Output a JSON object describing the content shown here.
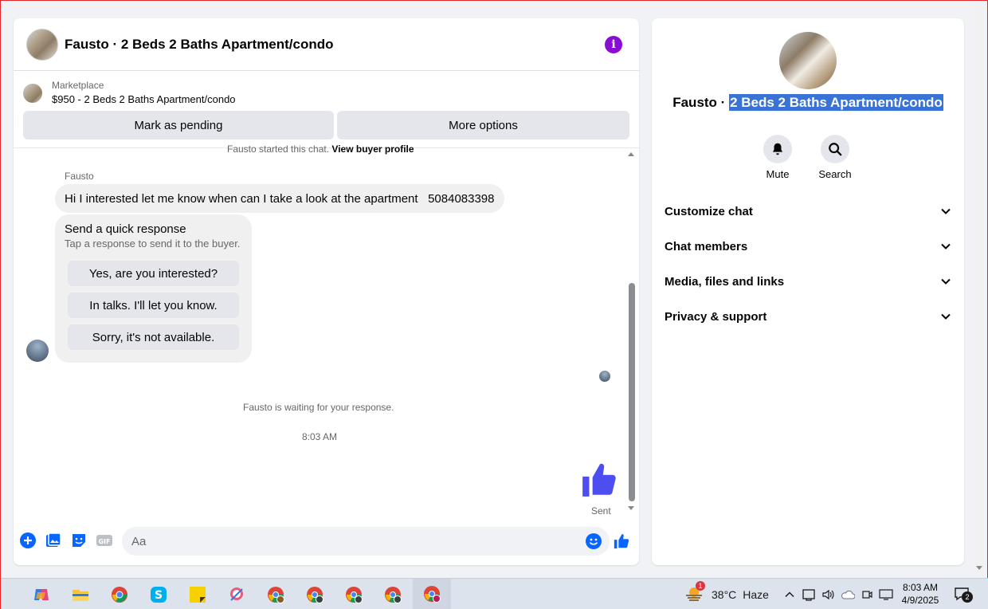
{
  "chat": {
    "title": "Fausto · 2 Beds 2 Baths Apartment/condo",
    "marketplace_label": "Marketplace",
    "listing": "$950 - 2 Beds 2 Baths Apartment/condo",
    "mark_pending": "Mark as pending",
    "more_options": "More options",
    "started_text": "Fausto started this chat.",
    "view_buyer_profile": "View buyer profile",
    "sender_name": "Fausto",
    "message": "Hi I interested let me know when can I take a look at the apartment   5084083398",
    "quick_title": "Send a quick response",
    "quick_subtitle": "Tap a response to send it to the buyer.",
    "quick_responses": [
      "Yes, are you interested?",
      "In talks. I'll let you know.",
      "Sorry, it's not available."
    ],
    "waiting_text": "Fausto is waiting for your response.",
    "time": "8:03 AM",
    "sent_label": "Sent",
    "input_placeholder": "Aa",
    "accent_color": "#0866ff",
    "like_color": "#4e4ef0",
    "info_color": "#8a0dd6"
  },
  "info_panel": {
    "name_prefix": "Fausto · ",
    "name_selected": "2 Beds 2 Baths Apartment/condo",
    "mute_label": "Mute",
    "search_label": "Search",
    "sections": [
      "Customize chat",
      "Chat members",
      "Media, files and links",
      "Privacy & support"
    ]
  },
  "taskbar": {
    "weather_temp": "38°C",
    "weather_desc": "Haze",
    "weather_badge": "1",
    "clock_time": "8:03 AM",
    "clock_date": "4/9/2025",
    "notification_count": "2",
    "apps": [
      "copilot-icon",
      "file-explorer-icon",
      "chrome-icon",
      "skype-icon",
      "sticky-notes-icon",
      "snipping-tool-icon",
      "chrome-profile-icon",
      "chrome-profile-icon",
      "chrome-profile-icon",
      "chrome-profile-icon",
      "chrome-profile-icon"
    ]
  }
}
